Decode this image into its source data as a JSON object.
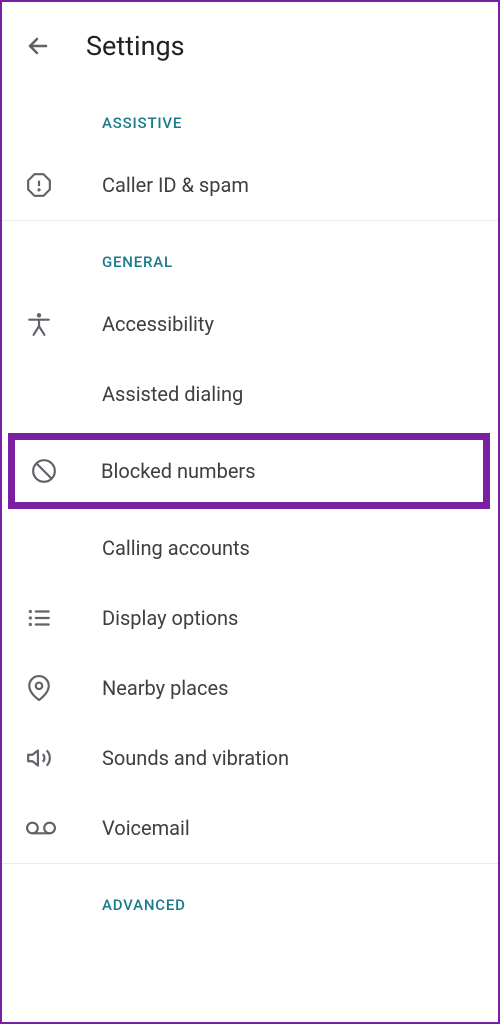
{
  "header": {
    "title": "Settings"
  },
  "sections": {
    "assistive": {
      "label": "ASSISTIVE",
      "caller_id": "Caller ID & spam"
    },
    "general": {
      "label": "GENERAL",
      "accessibility": "Accessibility",
      "assisted_dialing": "Assisted dialing",
      "blocked_numbers": "Blocked numbers",
      "calling_accounts": "Calling accounts",
      "display_options": "Display options",
      "nearby_places": "Nearby places",
      "sounds_vibration": "Sounds and vibration",
      "voicemail": "Voicemail"
    },
    "advanced": {
      "label": "ADVANCED"
    }
  }
}
